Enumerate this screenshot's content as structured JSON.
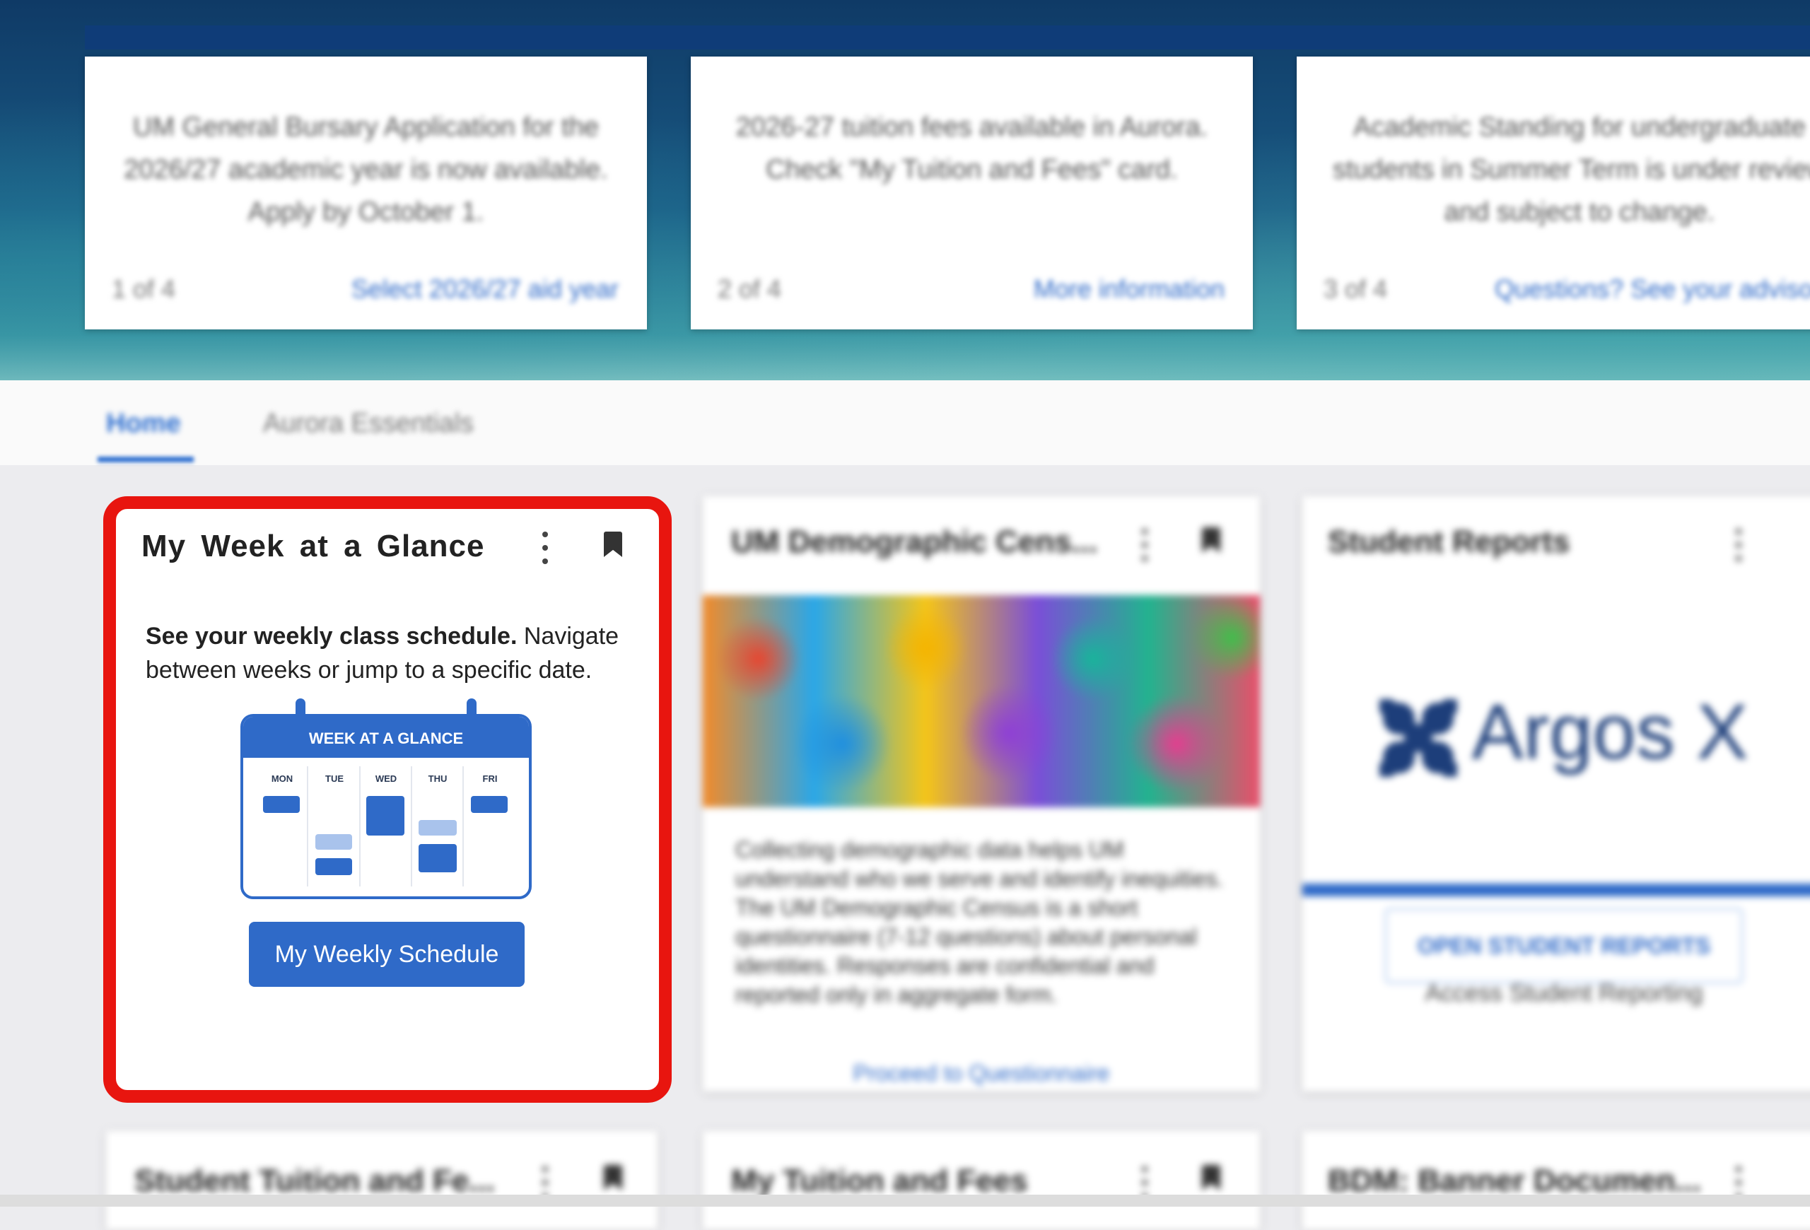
{
  "announcements": [
    {
      "text": "UM General Bursary Application for the 2026/27 academic year is now available. Apply by October 1.",
      "count": "1 of 4",
      "link": "Select 2026/27 aid year"
    },
    {
      "text": "2026-27 tuition fees available in Aurora. Check \"My Tuition and Fees\" card.",
      "count": "2 of 4",
      "link": "More information"
    },
    {
      "text": "Academic Standing for undergraduate students in Summer Term is under review and subject to change.",
      "count": "3 of 4",
      "link": "Questions? See your advisor"
    }
  ],
  "tabs": {
    "home": "Home",
    "essentials": "Aurora Essentials"
  },
  "focus_card": {
    "title": "My Week at a Glance",
    "desc_bold": "See your weekly class schedule.",
    "desc_rest": " Navigate between weeks or jump to a specific date.",
    "calendar": {
      "header": "WEEK AT A GLANCE",
      "days": [
        "MON",
        "TUE",
        "WED",
        "THU",
        "FRI"
      ]
    },
    "button": "My Weekly Schedule"
  },
  "census_card": {
    "title": "UM Demographic Cens...",
    "body": "Collecting demographic data helps UM understand who we serve and identify inequities. The UM Demographic Census is a short questionnaire (7-12 questions) about personal identities. Responses are confidential and reported only in aggregate form.",
    "link": "Proceed to Questionnaire"
  },
  "reports_card": {
    "title": "Student Reports",
    "logo_text": "Argos X",
    "button": "OPEN STUDENT REPORTS",
    "caption": "Access Student Reporting"
  },
  "bottom_cards": [
    "Student Tuition and Fe...",
    "My Tuition and Fees",
    "BDM: Banner Documen..."
  ],
  "colors": {
    "accent": "#2f6ac8",
    "highlight": "#e8150f"
  }
}
